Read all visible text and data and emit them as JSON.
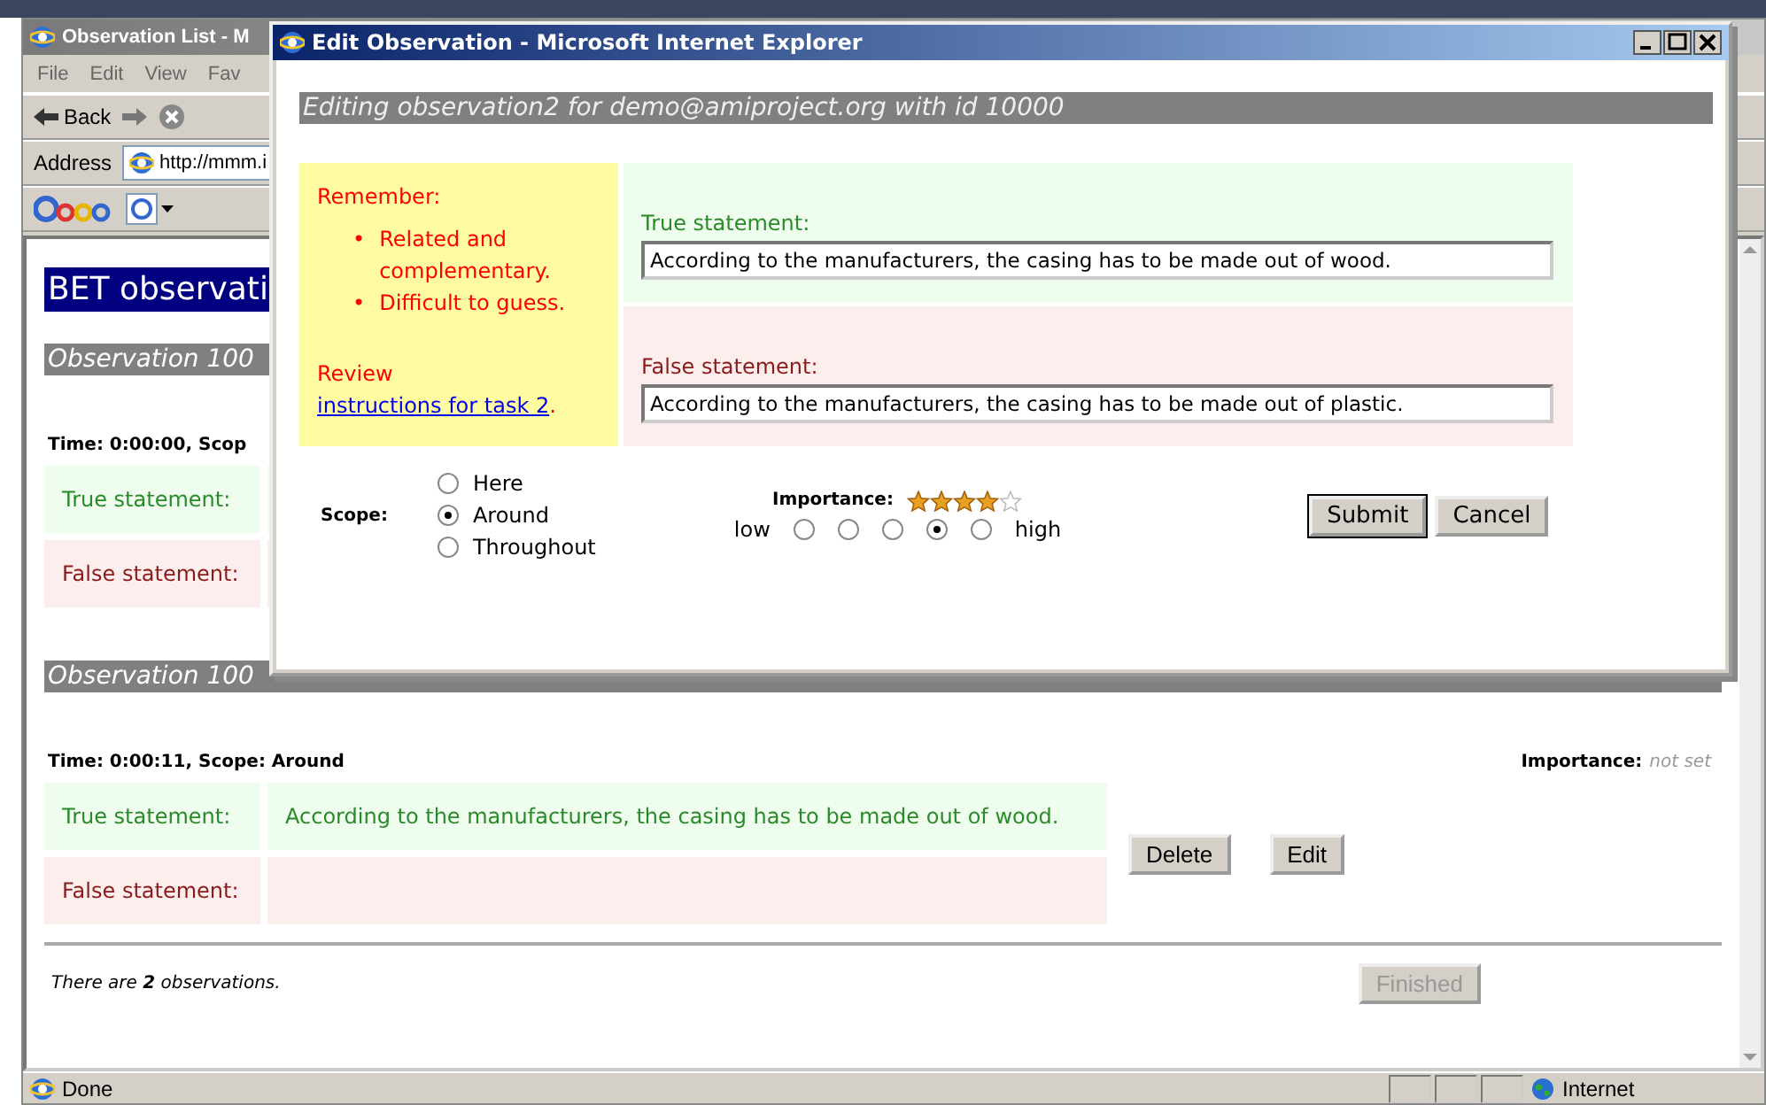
{
  "browser": {
    "title": "Observation List - M",
    "menu": [
      "File",
      "Edit",
      "View",
      "Fav"
    ],
    "back": "Back",
    "address_label": "Address",
    "address": "http://mmm.i",
    "status": "Done",
    "zone": "Internet"
  },
  "page": {
    "heading": "BET observati",
    "observations": [
      {
        "heading": "Observation 100",
        "time": "Time: 0:00:00, Scop",
        "rows": [
          {
            "kind": "true",
            "label": "True statement:"
          },
          {
            "kind": "false",
            "label": "False statement:"
          }
        ]
      },
      {
        "heading": "Observation 100",
        "time": "Time: 0:00:11, Scope: Around",
        "importance_label": "Importance:",
        "importance": "not set",
        "rows": [
          {
            "kind": "true",
            "label": "True statement:",
            "value": "According to the manufacturers, the casing has to be made out of wood."
          },
          {
            "kind": "false",
            "label": "False statement:"
          }
        ],
        "buttons": [
          "Delete",
          "Edit"
        ]
      }
    ],
    "summary": "There are **2** observations.",
    "finished": {
      "label": "Finished",
      "disabled": true
    }
  },
  "popup": {
    "title": "Edit Observation - Microsoft Internet Explorer",
    "heading": "Editing observation2 for demo@amiproject.org with id 10000",
    "remember": {
      "title": "Remember:",
      "marker": "•",
      "points": [
        "Related and complementary.",
        "Difficult to guess."
      ],
      "review": "Review",
      "link": "instructions for task 2",
      "after": "."
    },
    "statements": [
      {
        "kind": "true",
        "label": "True statement:",
        "value": "According to the manufacturers, the casing has to be made out of wood."
      },
      {
        "kind": "false",
        "label": "False statement:",
        "value": "According to the manufacturers, the casing has to be made out of plastic."
      }
    ],
    "scope": {
      "label": "Scope:",
      "options": [
        {
          "label": "Here",
          "selected": false
        },
        {
          "label": "Around",
          "selected": true
        },
        {
          "label": "Throughout",
          "selected": false
        }
      ]
    },
    "importance": {
      "label": "Importance:",
      "stars": 4,
      "low": "low",
      "high": "high",
      "options": [
        {
          "selected": false
        },
        {
          "selected": false
        },
        {
          "selected": false
        },
        {
          "selected": true
        },
        {
          "selected": false
        }
      ]
    },
    "buttons": [
      "Submit",
      "Cancel"
    ]
  }
}
